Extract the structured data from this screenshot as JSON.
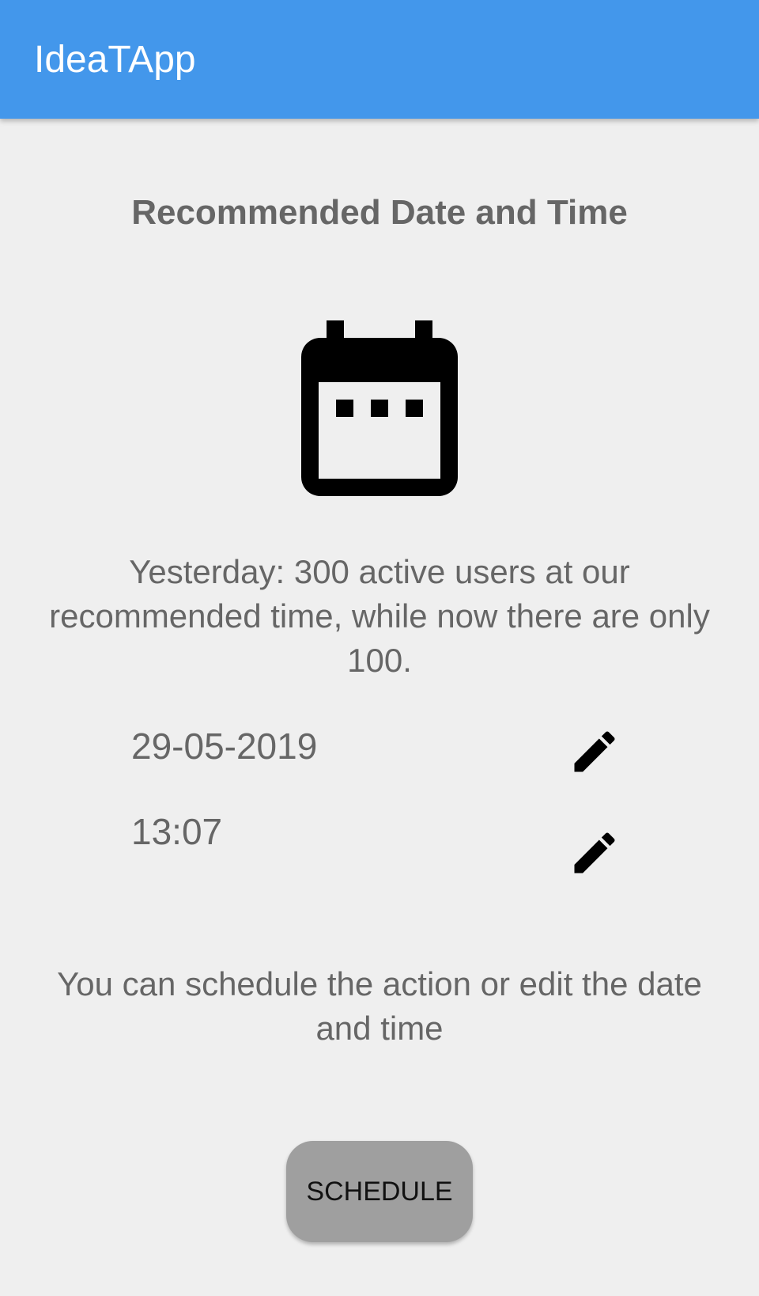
{
  "app_bar": {
    "title": "IdeaTApp",
    "color": "#4397eb"
  },
  "main": {
    "heading": "Recommended Date and Time",
    "hero_icon": "calendar-icon",
    "info_text": "Yesterday: 300 active users at our recommended time, while now there are only 100.",
    "date": {
      "value": "29-05-2019",
      "edit_icon": "pencil-icon"
    },
    "time": {
      "value": "13:07",
      "edit_icon": "pencil-icon"
    },
    "help_text": "You can schedule the action or edit the date and time"
  },
  "actions": {
    "schedule_label": "SCHEDULE"
  },
  "colors": {
    "background": "#efefef",
    "text": "#666666",
    "button": "#9f9f9f"
  }
}
